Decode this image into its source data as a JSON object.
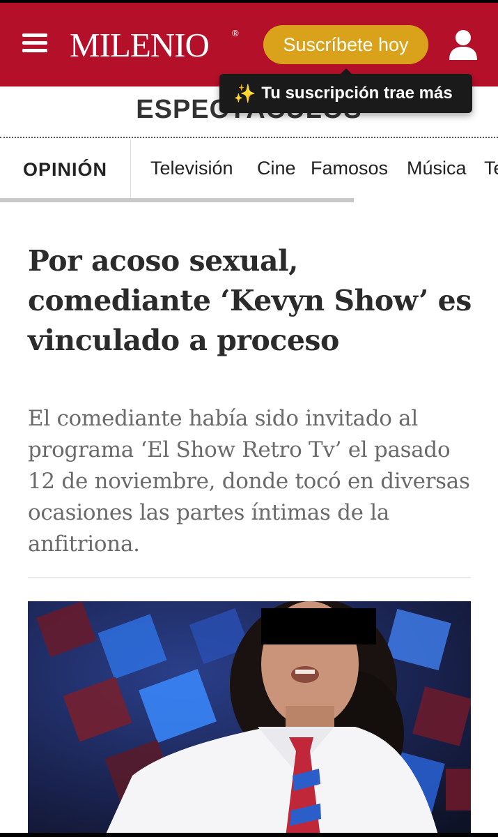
{
  "header": {
    "logo_text": "MILENIO",
    "logo_mark": "®",
    "subscribe_label": "Suscríbete hoy",
    "brand_color": "#b5102a",
    "button_color": "#d9a21a",
    "menu_icon": "hamburger-menu-icon",
    "user_icon": "user-account-icon"
  },
  "tooltip": {
    "icon": "sparkles-icon",
    "text": "Tu suscripción trae más"
  },
  "section": {
    "title": "ESPECTÁCULOS"
  },
  "nav": {
    "active_tab": "OPINIÓN",
    "tabs": [
      "Televisión",
      "Cine",
      "Famosos",
      "Música",
      "Te"
    ]
  },
  "article": {
    "headline": "Por acoso sexual, comediante ‘Kevyn Show’ es vinculado a proceso",
    "summary": "El comediante había sido invitado al programa ‘El Show Retro Tv’ el pasado 12 de noviembre, donde tocó en diversas ocasiones las partes íntimas de la anfitriona."
  }
}
